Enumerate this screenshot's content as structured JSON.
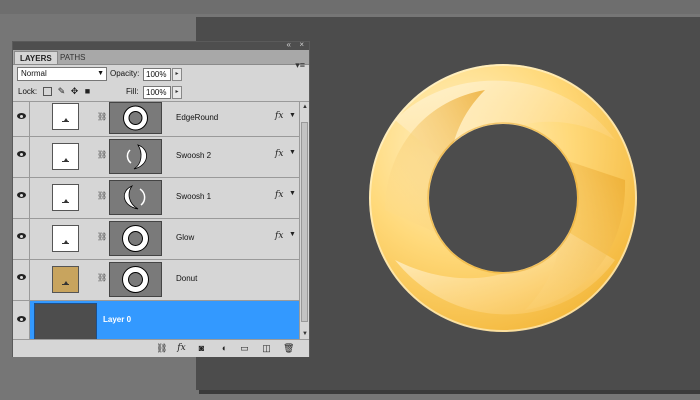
{
  "panel": {
    "tabs": [
      {
        "label": "LAYERS"
      },
      {
        "label": "PATHS"
      }
    ],
    "blend_mode": "Normal",
    "opacity_label": "Opacity:",
    "opacity_value": "100%",
    "lock_label": "Lock:",
    "fill_label": "Fill:",
    "fill_value": "100%",
    "fx_label": "fx"
  },
  "layers": [
    {
      "name": "EdgeRound",
      "has_fx": true,
      "selected": false,
      "mask": "ring"
    },
    {
      "name": "Swoosh 2",
      "has_fx": true,
      "selected": false,
      "mask": "swoosh2"
    },
    {
      "name": "Swoosh 1",
      "has_fx": true,
      "selected": false,
      "mask": "swoosh1"
    },
    {
      "name": "Glow",
      "has_fx": true,
      "selected": false,
      "mask": "ring"
    },
    {
      "name": "Donut",
      "has_fx": false,
      "selected": false,
      "mask": "ring"
    },
    {
      "name": "Layer 0",
      "has_fx": false,
      "selected": true,
      "mask": "none"
    }
  ],
  "colors": {
    "selection": "#3399ff",
    "donut_thumb": "#c8a45e",
    "canvas": "#4c4c4c",
    "donut_light": "#fff1c4",
    "donut_mid": "#ffd577",
    "donut_dark": "#f0b030"
  },
  "icons": [
    "eye-icon",
    "chain-link-icon",
    "fx-icon",
    "mask-icon",
    "adjustment-icon",
    "folder-icon",
    "new-layer-icon",
    "trash-icon"
  ]
}
